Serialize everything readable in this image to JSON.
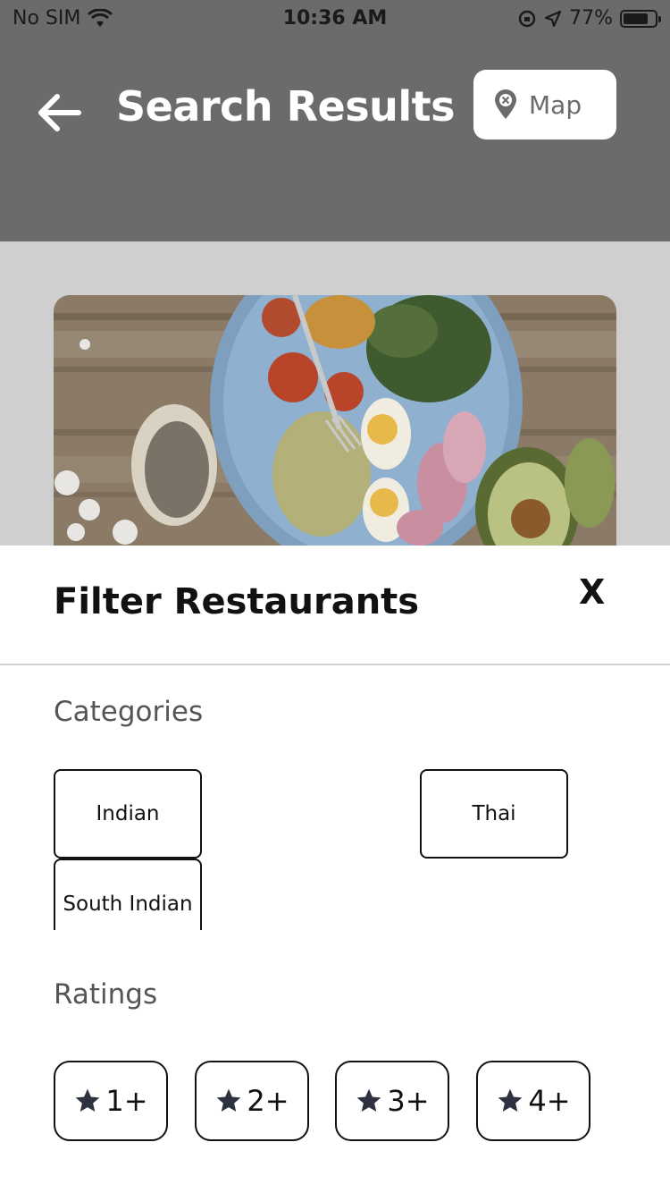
{
  "status_bar": {
    "carrier": "No SIM",
    "time": "10:36 AM",
    "battery": "77%",
    "icons": [
      "wifi-icon",
      "orientation-lock-icon",
      "location-arrow-icon",
      "battery-icon"
    ]
  },
  "header": {
    "title": "Search Results",
    "map_label": "Map",
    "back_icon": "arrow-left-icon",
    "map_icon": "map-pin-icon"
  },
  "modal": {
    "title": "Filter Restaurants",
    "close_label": "X",
    "categories_label": "Categories",
    "categories": [
      "Indian",
      "Thai",
      "South Indian"
    ],
    "ratings_label": "Ratings",
    "ratings": [
      "1+",
      "2+",
      "3+",
      "4+"
    ],
    "rating_icon": "star-icon"
  },
  "colors": {
    "overlay_header": "#6b6b6b",
    "content_bg": "#cfcfcf",
    "text_dark": "#111111",
    "text_muted": "#555555"
  }
}
